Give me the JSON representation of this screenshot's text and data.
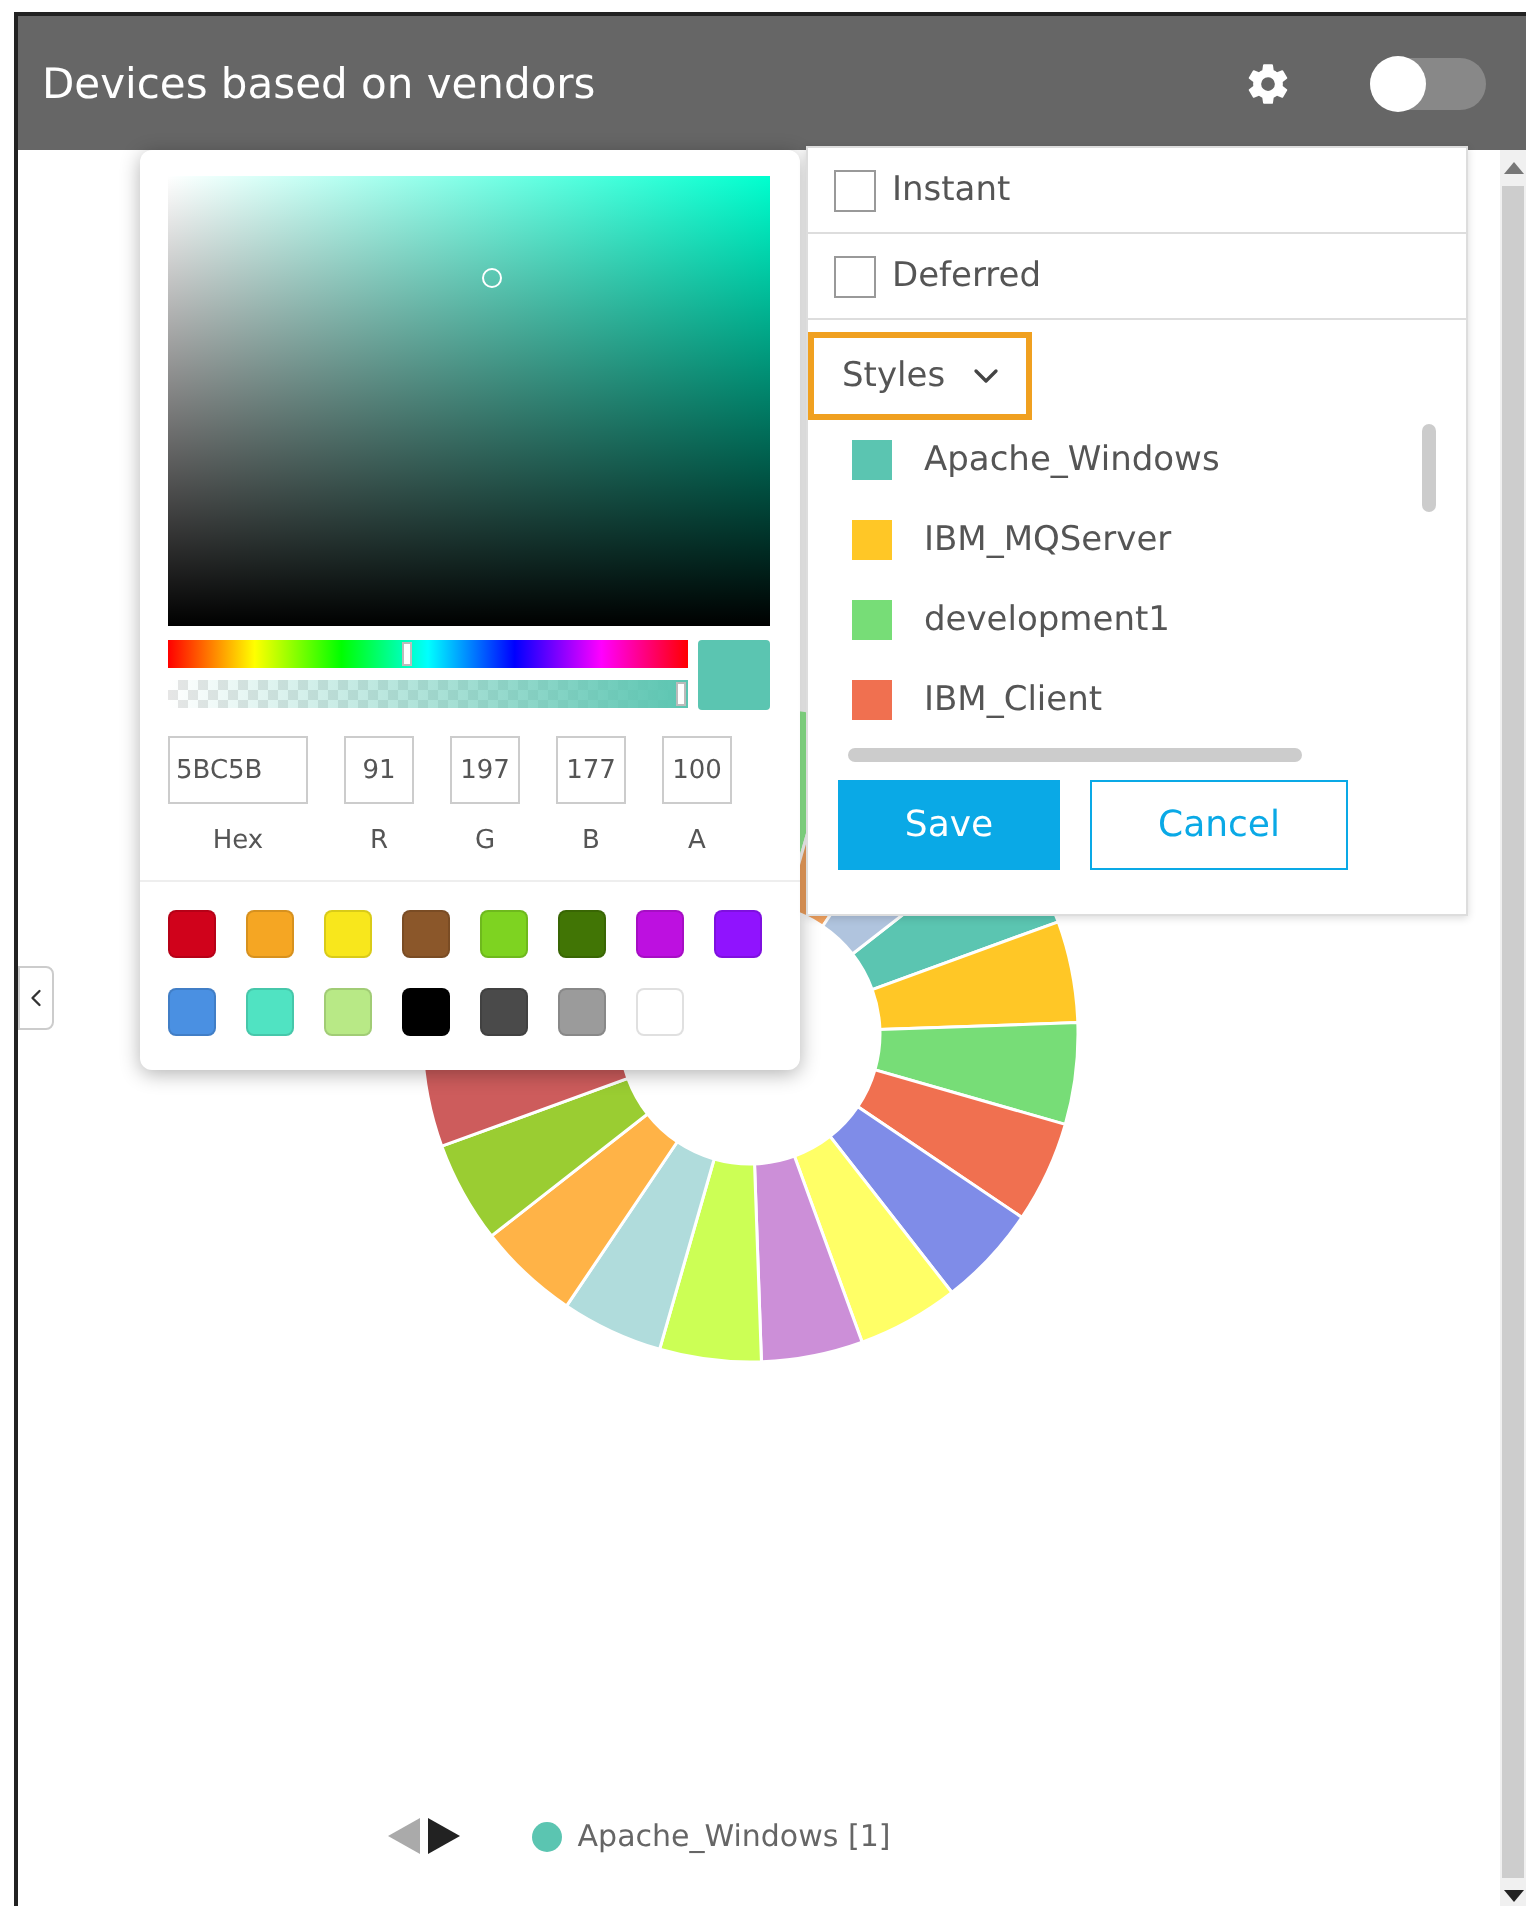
{
  "header": {
    "title": "Devices based on vendors",
    "toggle_on": false
  },
  "color_picker": {
    "hue_slider": {
      "level": 0.46
    },
    "alpha_slider": {
      "level": 1
    },
    "fields": [
      {
        "label": "Hex",
        "value": "5BC5B"
      },
      {
        "label": "R",
        "value": "91"
      },
      {
        "label": "G",
        "value": "197"
      },
      {
        "label": "B",
        "value": "177"
      },
      {
        "label": "A",
        "value": "100"
      }
    ],
    "swatches": [
      {
        "color": "#d0021b"
      },
      {
        "color": "#f5a623"
      },
      {
        "color": "#f8e71c"
      },
      {
        "color": "#8b572a"
      },
      {
        "color": "#7ed321"
      },
      {
        "color": "#417505"
      },
      {
        "color": "#bd10e0"
      },
      {
        "color": "#9013fe"
      },
      {
        "color": "#4a90e2"
      },
      {
        "color": "#50e3c2"
      },
      {
        "color": "#b8e986"
      },
      {
        "color": "#000000"
      },
      {
        "color": "#4a4a4a"
      },
      {
        "color": "#9b9b9b"
      },
      {
        "color": "#ffffff"
      }
    ]
  },
  "settings_menu": {
    "options": [
      {
        "label": "Instant",
        "checked": false
      },
      {
        "label": "Deferred",
        "checked": false
      }
    ],
    "styles_button": {
      "label": "Styles",
      "focused": true
    },
    "styles": [
      {
        "label": "Apache_Windows",
        "color": "#5bc5b1"
      },
      {
        "label": "IBM_MQServer",
        "color": "#ffc726"
      },
      {
        "label": "development1",
        "color": "#77dd77"
      },
      {
        "label": "IBM_Client",
        "color": "#f07050"
      }
    ],
    "buttons": {
      "save": "Save",
      "cancel": "Cancel"
    }
  },
  "legend": {
    "items": [
      {
        "label": "Apache_Windows [1]",
        "color": "#5bc5b1"
      }
    ]
  }
}
